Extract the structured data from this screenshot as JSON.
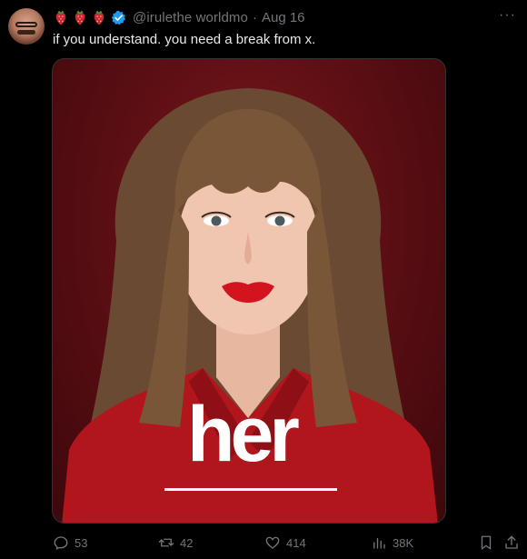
{
  "tweet": {
    "author_emoji": [
      "strawberry",
      "strawberry",
      "strawberry"
    ],
    "handle": "@irulethe worldmo",
    "separator": "·",
    "date": "Aug 16",
    "text": "if you understand. you need a break from x.",
    "media": {
      "brand_text": "her"
    },
    "stats": {
      "replies": "53",
      "reposts": "42",
      "likes": "414",
      "views": "38K"
    }
  },
  "colors": {
    "background": "#000000",
    "text_primary": "#e7e9ea",
    "text_secondary": "#71767b",
    "verified": "#1d9bf0",
    "poster_red": "#7a1a1d"
  }
}
